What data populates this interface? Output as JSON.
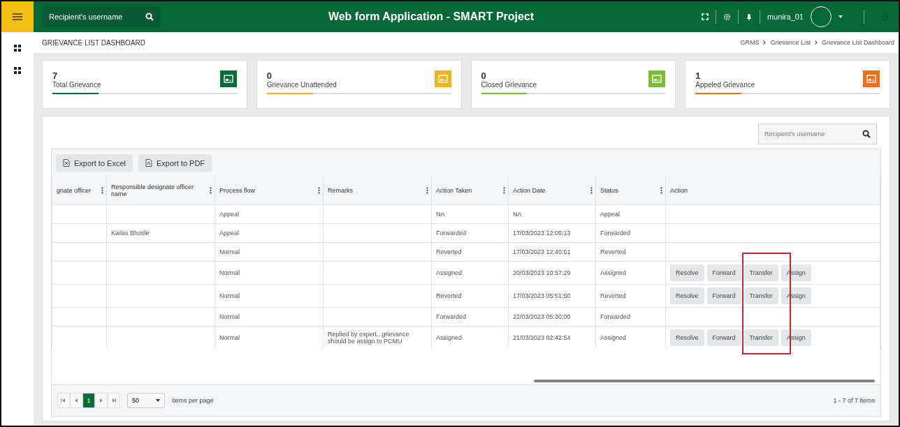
{
  "topbar": {
    "search_placeholder": "Recipient's username",
    "title": "Web form Application - SMART Project",
    "username": "munira_01"
  },
  "page_title": "GRIEVANCE LIST DASHBOARD",
  "breadcrumb": [
    "GRMS",
    "Grievance List",
    "Grievance List Dashboard"
  ],
  "cards": [
    {
      "count": "7",
      "label": "Total Grievance",
      "color": "#0b6b3a",
      "level": 0.25
    },
    {
      "count": "0",
      "label": "Grievance Unattended",
      "color": "#f0b323",
      "level": 0.25
    },
    {
      "count": "0",
      "label": "Closed Grievance",
      "color": "#7dbb3c",
      "level": 0.25
    },
    {
      "count": "1",
      "label": "Appeled Grievance",
      "color": "#e8731c",
      "level": 0.25
    }
  ],
  "grid_search": {
    "placeholder": "Recipient's username"
  },
  "toolbar": [
    {
      "label": "Export to Excel",
      "kind": "excel"
    },
    {
      "label": "Export to PDF",
      "kind": "pdf"
    }
  ],
  "table": {
    "columns": [
      {
        "label": "gnate officer",
        "menu": true
      },
      {
        "label": "Responsible designate officer name",
        "menu": true
      },
      {
        "label": "Process flow",
        "menu": true
      },
      {
        "label": "Remarks",
        "menu": true
      },
      {
        "label": "Action Taken",
        "menu": true
      },
      {
        "label": "Action Date",
        "menu": true
      },
      {
        "label": "Status",
        "menu": true
      },
      {
        "label": "Action",
        "menu": false
      }
    ],
    "rows": [
      {
        "cells": [
          "",
          "",
          "Appeal",
          "",
          "NA",
          "NA",
          "Appeal"
        ],
        "actions": []
      },
      {
        "cells": [
          "",
          "Kailas Bhosle",
          "Appeal",
          "",
          "Forwarded",
          "17/03/2023 12:09:13",
          "Forwarded"
        ],
        "actions": []
      },
      {
        "cells": [
          "",
          "",
          "Normal",
          "",
          "Reverted",
          "17/03/2023 12:40:51",
          "Reverted"
        ],
        "actions": []
      },
      {
        "cells": [
          "",
          "",
          "Normal",
          "",
          "Assigned",
          "20/03/2023 10:57:29",
          "Assigned"
        ],
        "actions": [
          "Resolve",
          "Forward",
          "Transfer",
          "Assign"
        ]
      },
      {
        "cells": [
          "",
          "",
          "Normal",
          "",
          "Reverted",
          "17/03/2023 05:51:50",
          "Reverted"
        ],
        "actions": [
          "Resolve",
          "Forward",
          "Transfer",
          "Assign"
        ]
      },
      {
        "cells": [
          "",
          "",
          "Normal",
          "",
          "Forwarded",
          "22/03/2023 05:30:00",
          "Forwarded"
        ],
        "actions": []
      },
      {
        "cells": [
          "",
          "",
          "Normal",
          "Replied by expert...grievance should be assign to PCMU",
          "Assigned",
          "21/03/2023 02:42:54",
          "Assigned"
        ],
        "actions": [
          "Resolve",
          "Forward",
          "Transfer",
          "Assign"
        ]
      }
    ]
  },
  "pager": {
    "pages": [
      {
        "label": "1",
        "selected": true
      }
    ],
    "page_size": "50",
    "page_size_label": "items per page",
    "summary": "1 - 7 of 7 items"
  }
}
